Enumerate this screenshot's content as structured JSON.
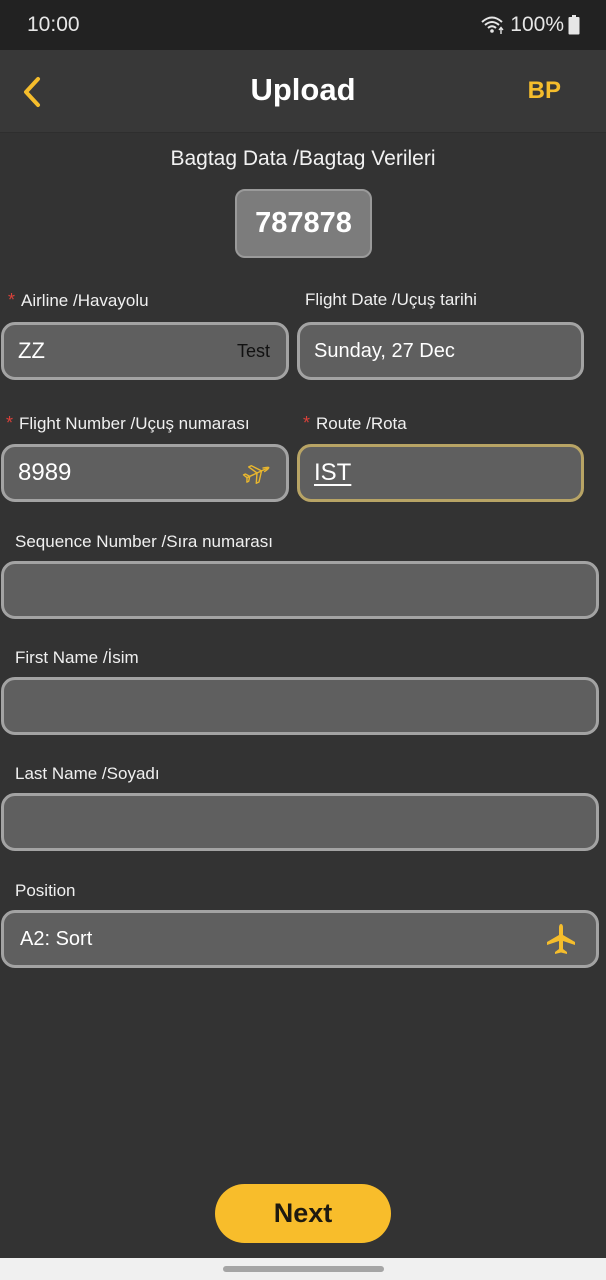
{
  "status_bar": {
    "time": "10:00",
    "battery": "100%",
    "icons": [
      "wifi-icon",
      "battery-icon"
    ]
  },
  "app_bar": {
    "title": "Upload",
    "back_icon": "chevron-left-icon",
    "action_label": "BP"
  },
  "bagtag": {
    "section_title": "Bagtag Data /Bagtag Verileri",
    "value": "787878"
  },
  "form": {
    "airline": {
      "label": "Airline /Havayolu",
      "required": "*",
      "value": "ZZ",
      "suffix": "Test"
    },
    "flight_date": {
      "label": "Flight Date /Uçuş tarihi",
      "value": "Sunday, 27 Dec"
    },
    "flight_number": {
      "label": "Flight Number /Uçuş numarası",
      "required": "*",
      "value": "8989",
      "icon": "airplane-takeoff-icon"
    },
    "route": {
      "label": "Route /Rota",
      "required": "*",
      "value": "IST"
    },
    "sequence_number": {
      "label": "Sequence Number /Sıra numarası",
      "value": ""
    },
    "first_name": {
      "label": "First Name /İsim",
      "value": ""
    },
    "last_name": {
      "label": "Last Name /Soyadı",
      "value": ""
    },
    "position": {
      "label": "Position",
      "value": "A2: Sort",
      "icon": "airplane-icon"
    }
  },
  "actions": {
    "next_label": "Next"
  },
  "colors": {
    "accent": "#f8bd2b",
    "required": "#d9413a",
    "background": "#333333",
    "field_bg": "#5f5f5f"
  }
}
